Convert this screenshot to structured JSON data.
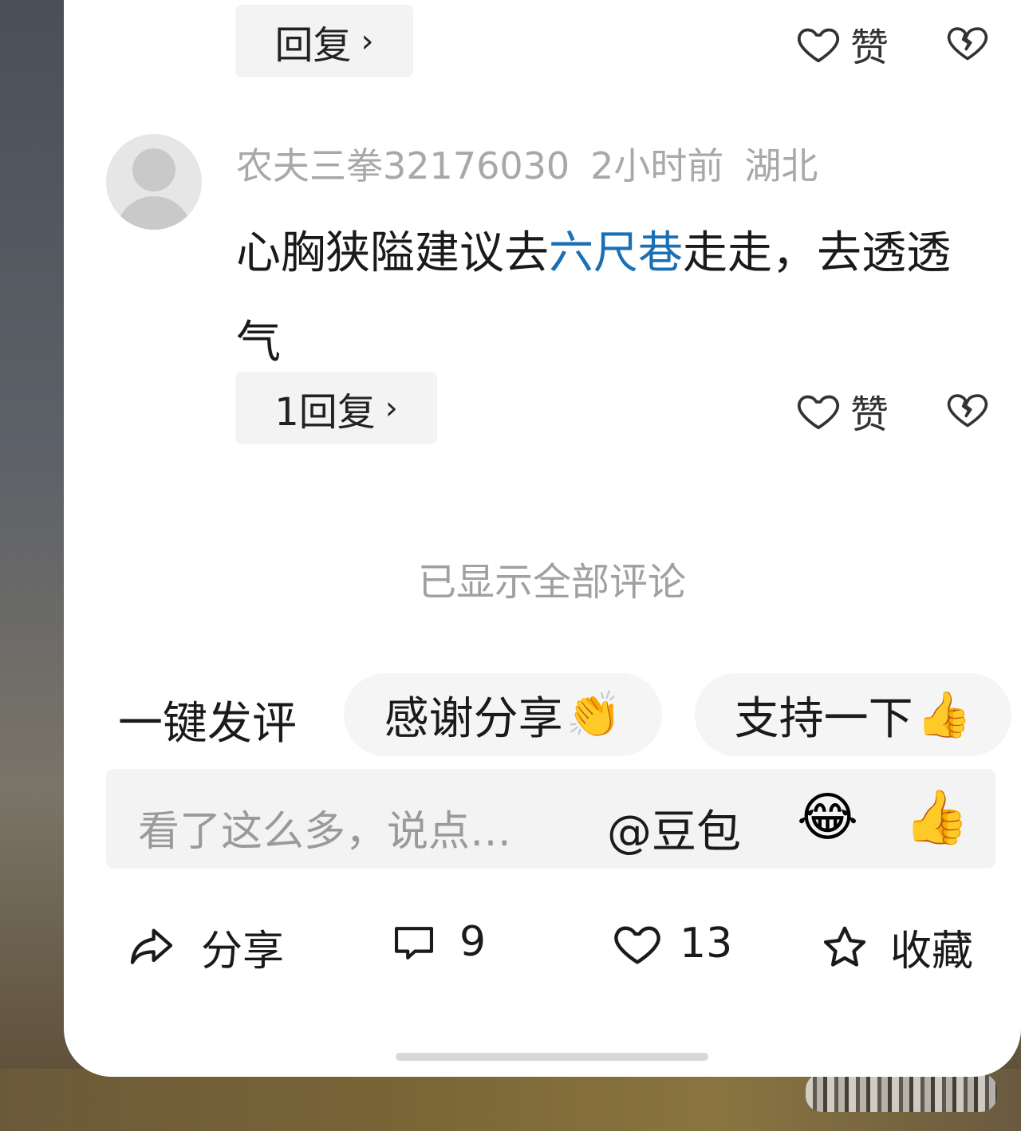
{
  "prev_comment": {
    "reply_label": "回复",
    "like_label": "赞"
  },
  "comment": {
    "username": "农夫三拳32176030",
    "time": "2小时前",
    "location": "湖北",
    "text_before": "心胸狭隘建议去",
    "text_link": "六尺巷",
    "text_after": "走走，去透透气",
    "reply_label": "1回复",
    "like_label": "赞"
  },
  "all_shown": "已显示全部评论",
  "quick_comment": {
    "title": "一键发评",
    "chips": [
      {
        "text": "感谢分享",
        "emoji": "👏"
      },
      {
        "text": "支持一下",
        "emoji": "👍"
      }
    ]
  },
  "input": {
    "placeholder": "看了这么多，说点…",
    "at_label": "@豆包",
    "emoji_1": "😂",
    "emoji_2": "👍"
  },
  "bottom_bar": {
    "share": "分享",
    "comments": "9",
    "likes": "13",
    "favorite": "收藏"
  }
}
